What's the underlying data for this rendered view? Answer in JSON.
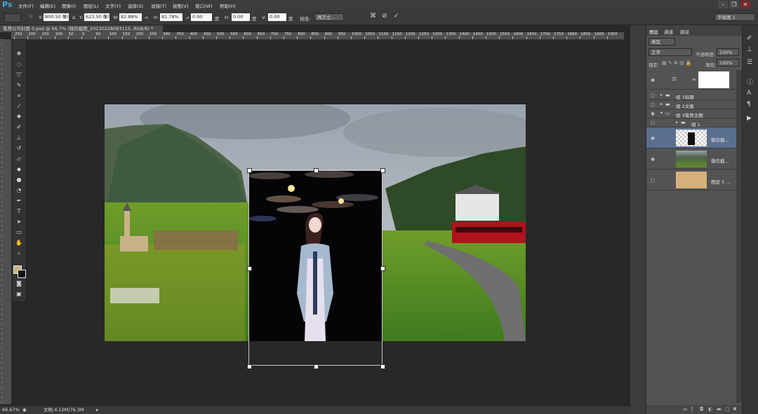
{
  "menubar": {
    "logo": "Ps",
    "items": [
      "文件(F)",
      "编辑(E)",
      "图像(I)",
      "图层(L)",
      "文字(Y)",
      "选择(S)",
      "滤镜(T)",
      "视图(V)",
      "窗口(W)",
      "帮助(H)"
    ],
    "window_buttons": [
      "–",
      "❐",
      "✕"
    ]
  },
  "options": {
    "x_label": "X:",
    "x_value": "800.50 像!",
    "y_label": "Y:",
    "y_value": "623.50 像!",
    "w_label": "W:",
    "w_value": "82.88%",
    "h_label": "H:",
    "h_value": "82.78%",
    "angle_value": "0.00",
    "angle_unit": "度",
    "hskew_label": "H:",
    "hskew_value": "0.00",
    "hskew_unit": "度",
    "vskew_label": "V:",
    "vskew_value": "0.00",
    "vskew_unit": "度",
    "interp_label": "插值:",
    "interp_value": "两次立...",
    "workspace": "手绘图 1"
  },
  "document": {
    "tab_title": "笔荷公司封面 0.psd @ 66.7% (微信截图_20230228083115, RGB/8) *"
  },
  "ruler": {
    "marks": [
      "250",
      "200",
      "150",
      "100",
      "50",
      "0",
      "50",
      "100",
      "150",
      "200",
      "250",
      "300",
      "350",
      "400",
      "450",
      "500",
      "550",
      "600",
      "650",
      "700",
      "750",
      "800",
      "850",
      "900",
      "950",
      "1000",
      "1050",
      "1100",
      "1150",
      "1200",
      "1250",
      "1300",
      "1350",
      "1400",
      "1450",
      "1500",
      "1550",
      "1600",
      "1650",
      "1700",
      "1750",
      "1800",
      "1850",
      "1900",
      "1950"
    ]
  },
  "status": {
    "zoom": "66.67%",
    "doc": "文档:4.12M/76.3M"
  },
  "panels": {
    "tabs": [
      "图层",
      "通道",
      "路径"
    ],
    "kind_filter": "类型",
    "blend_mode": "正常",
    "opacity_label": "不透明度:",
    "opacity_value": "100%",
    "lock_label": "锁定:",
    "fill_label": "填充:",
    "fill_value": "100%",
    "layers": [
      {
        "name": "组 1标题"
      },
      {
        "name": "组 2文案"
      },
      {
        "name": "组 3笔荷主图"
      },
      {
        "name": "组 1"
      },
      {
        "name": "微信截..."
      },
      {
        "name": "微信截..."
      },
      {
        "name": "图层 5 ..."
      }
    ]
  },
  "colors": {
    "accent": "#3fa8e6",
    "selected_layer": "#5a6f8f",
    "foreground_swatch": "#c8b27a",
    "tan_layer": "#d6b07c"
  }
}
